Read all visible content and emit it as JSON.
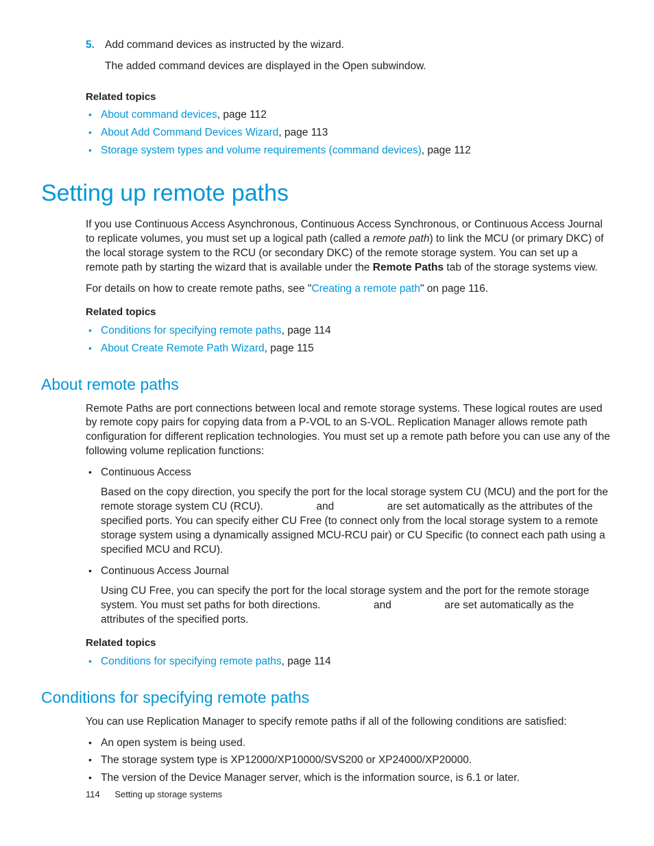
{
  "step5": {
    "number": "5.",
    "line1": "Add command devices as instructed by the wizard.",
    "line2": "The added command devices are displayed in the Open subwindow."
  },
  "related1": {
    "heading": "Related topics",
    "items": [
      {
        "link": "About command devices",
        "suffix": ", page 112"
      },
      {
        "link": "About Add Command Devices Wizard",
        "suffix": ", page 113"
      },
      {
        "link": "Storage system types and volume requirements (command devices)",
        "suffix": ", page 112"
      }
    ]
  },
  "h1": "Setting up remote paths",
  "para1": {
    "a": "If you use Continuous Access Asynchronous, Continuous Access Synchronous, or Continuous Access Journal to replicate volumes, you must set up a logical path (called a ",
    "i": "remote path",
    "b": ") to link the MCU (or primary DKC) of the local storage system to the RCU (or secondary DKC) of the remote storage system. You can set up a remote path by starting the wizard that is available under the ",
    "bold": "Remote Paths",
    "c": " tab of the storage systems view."
  },
  "para2": {
    "a": "For details on how to create remote paths, see \"",
    "link": "Creating a remote path",
    "b": "\" on page 116."
  },
  "related2": {
    "heading": "Related topics",
    "items": [
      {
        "link": "Conditions for specifying remote paths",
        "suffix": ", page 114"
      },
      {
        "link": "About Create Remote Path Wizard",
        "suffix": ", page 115"
      }
    ]
  },
  "h2a": "About remote paths",
  "h2a_para": "Remote Paths are port connections between local and remote storage systems. These logical routes are used by remote copy pairs for copying data from a P-VOL to an S-VOL. Replication Manager allows remote path configuration for different replication technologies. You must set up a remote path before you can use any of the following volume replication functions:",
  "ca": {
    "title": "Continuous Access",
    "body_a": "Based on the copy direction, you specify the port for the local storage system CU (MCU) and the port for the remote storage system CU (RCU). ",
    "body_b": " and ",
    "body_c": " are set automatically as the attributes of the specified ports. You can specify either CU Free (to connect only from the local storage system to a remote storage system using a dynamically assigned MCU-RCU pair) or CU Specific (to connect each path using a specified MCU and RCU)."
  },
  "caj": {
    "title": "Continuous Access Journal",
    "body_a": "Using CU Free, you can specify the port for the local storage system and the port for the remote storage system. You must set paths for both directions. ",
    "body_b": " and ",
    "body_c": " are set automatically as the attributes of the specified ports."
  },
  "related3": {
    "heading": "Related topics",
    "items": [
      {
        "link": "Conditions for specifying remote paths",
        "suffix": ", page 114"
      }
    ]
  },
  "h2b": "Conditions for specifying remote paths",
  "h2b_para": "You can use Replication Manager to specify remote paths if all of the following conditions are satisfied:",
  "conditions": [
    "An open system is being used.",
    "The storage system type is XP12000/XP10000/SVS200 or XP24000/XP20000.",
    "The version of the Device Manager server, which is the information source, is 6.1 or later."
  ],
  "footer": {
    "page": "114",
    "title": "Setting up storage systems"
  }
}
